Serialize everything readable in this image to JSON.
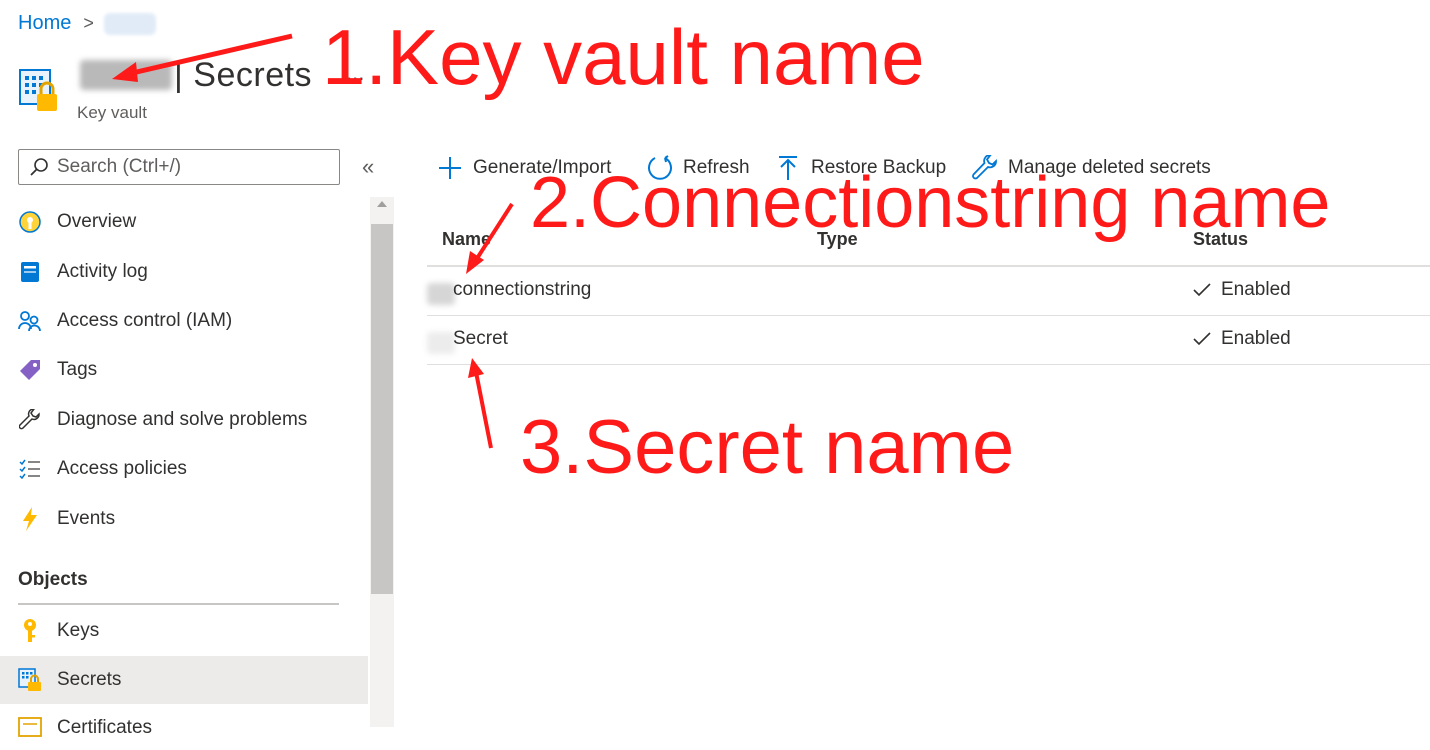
{
  "breadcrumb": {
    "home": "Home",
    "separator": ">"
  },
  "header": {
    "title": "| Secrets",
    "more": "...",
    "subtitle": "Key vault"
  },
  "search": {
    "placeholder": "Search (Ctrl+/)"
  },
  "collapse_label": "«",
  "sidebar": {
    "items": [
      {
        "label": "Overview",
        "icon": "overview-icon"
      },
      {
        "label": "Activity log",
        "icon": "activity-log-icon"
      },
      {
        "label": "Access control (IAM)",
        "icon": "users-icon"
      },
      {
        "label": "Tags",
        "icon": "tag-icon"
      },
      {
        "label": "Diagnose and solve problems",
        "icon": "wrench-icon"
      },
      {
        "label": "Access policies",
        "icon": "checklist-icon"
      },
      {
        "label": "Events",
        "icon": "lightning-icon"
      }
    ],
    "section": "Objects",
    "objects": [
      {
        "label": "Keys",
        "icon": "key-icon"
      },
      {
        "label": "Secrets",
        "icon": "secret-icon",
        "active": true
      },
      {
        "label": "Certificates",
        "icon": "certificate-icon"
      }
    ]
  },
  "toolbar": {
    "generate": "Generate/Import",
    "refresh": "Refresh",
    "restore": "Restore Backup",
    "manage": "Manage deleted secrets"
  },
  "table": {
    "columns": [
      "Name",
      "Type",
      "Status"
    ],
    "rows": [
      {
        "name": "connectionstring",
        "type": "",
        "status": "Enabled"
      },
      {
        "name": "Secret",
        "type": "",
        "status": "Enabled"
      }
    ]
  },
  "annotations": {
    "a1": "1.Key vault name",
    "a2": "2.Connectionstring name",
    "a3": "3.Secret name"
  },
  "colors": {
    "accent": "#0078d4",
    "annotation": "#ff1a1a"
  }
}
